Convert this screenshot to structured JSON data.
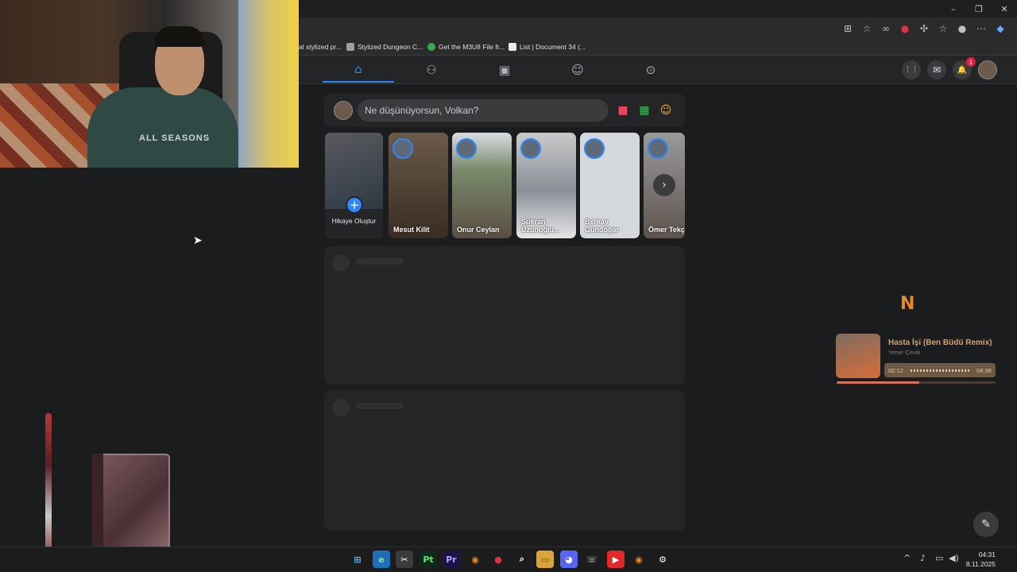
{
  "browser": {
    "window_controls": {
      "minimize": "–",
      "maximize": "❐",
      "close": "✕"
    },
    "bookmarks": [
      {
        "label": "al stylized pr...",
        "icon": "doc-icon",
        "color": "#2b2b2b"
      },
      {
        "label": "Stylized Dungeon C...",
        "icon": "link-icon",
        "color": "#9aa0a6"
      },
      {
        "label": "Get the M3U8 File fr...",
        "icon": "check-icon",
        "color": "#34a853"
      },
      {
        "label": "List | Document 34 (...",
        "icon": "doc-icon",
        "color": "#e8eaed"
      }
    ]
  },
  "facebook": {
    "nav_tabs": [
      {
        "name": "home",
        "icon": "⌂",
        "active": true
      },
      {
        "name": "friends",
        "icon": "⚇",
        "active": false
      },
      {
        "name": "watch",
        "icon": "▣",
        "active": false
      },
      {
        "name": "groups",
        "icon": "☺",
        "active": false
      },
      {
        "name": "gaming",
        "icon": "⊙",
        "active": false
      }
    ],
    "right_buttons": {
      "menu": "⋮⋮",
      "messenger": "✉",
      "notifications": "🔔"
    },
    "notification_count": "1",
    "composer": {
      "placeholder": "Ne düşünüyorsun, Volkan?",
      "live_video_icon": "■",
      "photo_icon": "▦",
      "feeling_icon": "☺"
    },
    "stories": {
      "create_label": "Hikaye Oluştur",
      "create_plus": "+",
      "items": [
        {
          "name": "Mesut Kilit",
          "bg": "#4a3a2e"
        },
        {
          "name": "Onur Ceylan",
          "bg": "#5b5a52"
        },
        {
          "name": "Şükran Uzunoğlu...",
          "bg": "#8a8f96"
        },
        {
          "name": "Berkay Gündoğar",
          "bg": "#c9ccd1"
        },
        {
          "name": "Ömer Tekçe",
          "bg": "#6b5e58"
        }
      ],
      "next_icon": "›"
    },
    "edit_icon": "✎"
  },
  "webcam": {
    "shirt_text": "ALL SEASONS"
  },
  "music": {
    "title": "Hasta İşi (Ben Büdü Remix)",
    "artist": "Yener Çevik",
    "elapsed": "02:12",
    "total": "04:38",
    "progress": 0.52,
    "logo": "N"
  },
  "taskbar": {
    "apps": [
      {
        "name": "windows-start",
        "label": "⊞",
        "bg": "#1c1c1c",
        "fg": "#4cc2ff"
      },
      {
        "name": "edge",
        "label": "e",
        "bg": "#1f6fb8",
        "fg": "#7fe0a0"
      },
      {
        "name": "snipping",
        "label": "✂",
        "bg": "#3b3b3b",
        "fg": "#ffffff"
      },
      {
        "name": "painter",
        "label": "Pt",
        "bg": "#0e2a1d",
        "fg": "#6ee06e"
      },
      {
        "name": "premiere",
        "label": "Pr",
        "bg": "#1d1445",
        "fg": "#b6a2ff"
      },
      {
        "name": "blender",
        "label": "◉",
        "bg": "#1c1c1c",
        "fg": "#f08a1c"
      },
      {
        "name": "record",
        "label": "●",
        "bg": "#1c1c1c",
        "fg": "#e0304a"
      },
      {
        "name": "search-app",
        "label": "⌕",
        "bg": "#1c1c1c",
        "fg": "#ffffff"
      },
      {
        "name": "file-explorer",
        "label": "▭",
        "bg": "#d9a53a",
        "fg": "#7a4d00"
      },
      {
        "name": "discord",
        "label": "◕",
        "bg": "#5865f2",
        "fg": "#ffffff"
      },
      {
        "name": "whatsapp",
        "label": "☏",
        "bg": "#1c1c1c",
        "fg": "#d0d0d0"
      },
      {
        "name": "youtube",
        "label": "▶",
        "bg": "#e02a2a",
        "fg": "#ffffff"
      },
      {
        "name": "blender-2",
        "label": "◉",
        "bg": "#1c1c1c",
        "fg": "#f08a1c"
      },
      {
        "name": "settings",
        "label": "⚙",
        "bg": "#1c1c1c",
        "fg": "#ffffff"
      }
    ],
    "tray": {
      "chevron": "^",
      "mic": "♪",
      "network": "▭",
      "volume": "◀)"
    },
    "time": "04:31",
    "date": "8.11.2025"
  }
}
